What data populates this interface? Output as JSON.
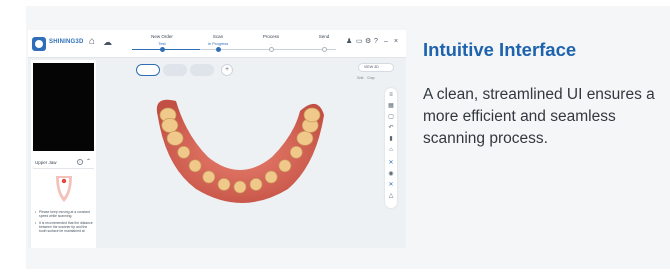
{
  "app": {
    "logo_text": "SHINING3D",
    "logo_sub": "",
    "steps": [
      {
        "title": "New Order",
        "status": "Test",
        "state": "done"
      },
      {
        "title": "Scan",
        "status": "In Progress",
        "state": "active"
      },
      {
        "title": "Process",
        "status": "-",
        "state": "pending"
      },
      {
        "title": "Send",
        "status": "-",
        "state": "pending"
      }
    ],
    "current_step": 2,
    "panel_title": "Upper Jaw",
    "view_label": "VIEW 3D",
    "toggles": [
      "Grid",
      "Crop"
    ],
    "tips": [
      "Please keep moving at a constant speed while scanning.",
      "It is recommended that the distance between the scanner tip and the tooth surface be maintained at"
    ],
    "colors": {
      "brand": "#2f6fb7",
      "gum": "#d9695a",
      "tooth": "#f0c98a"
    }
  },
  "headline": "Intuitive Interface",
  "body": "A clean, streamlined UI ensures a more efficient and seamless scanning process."
}
